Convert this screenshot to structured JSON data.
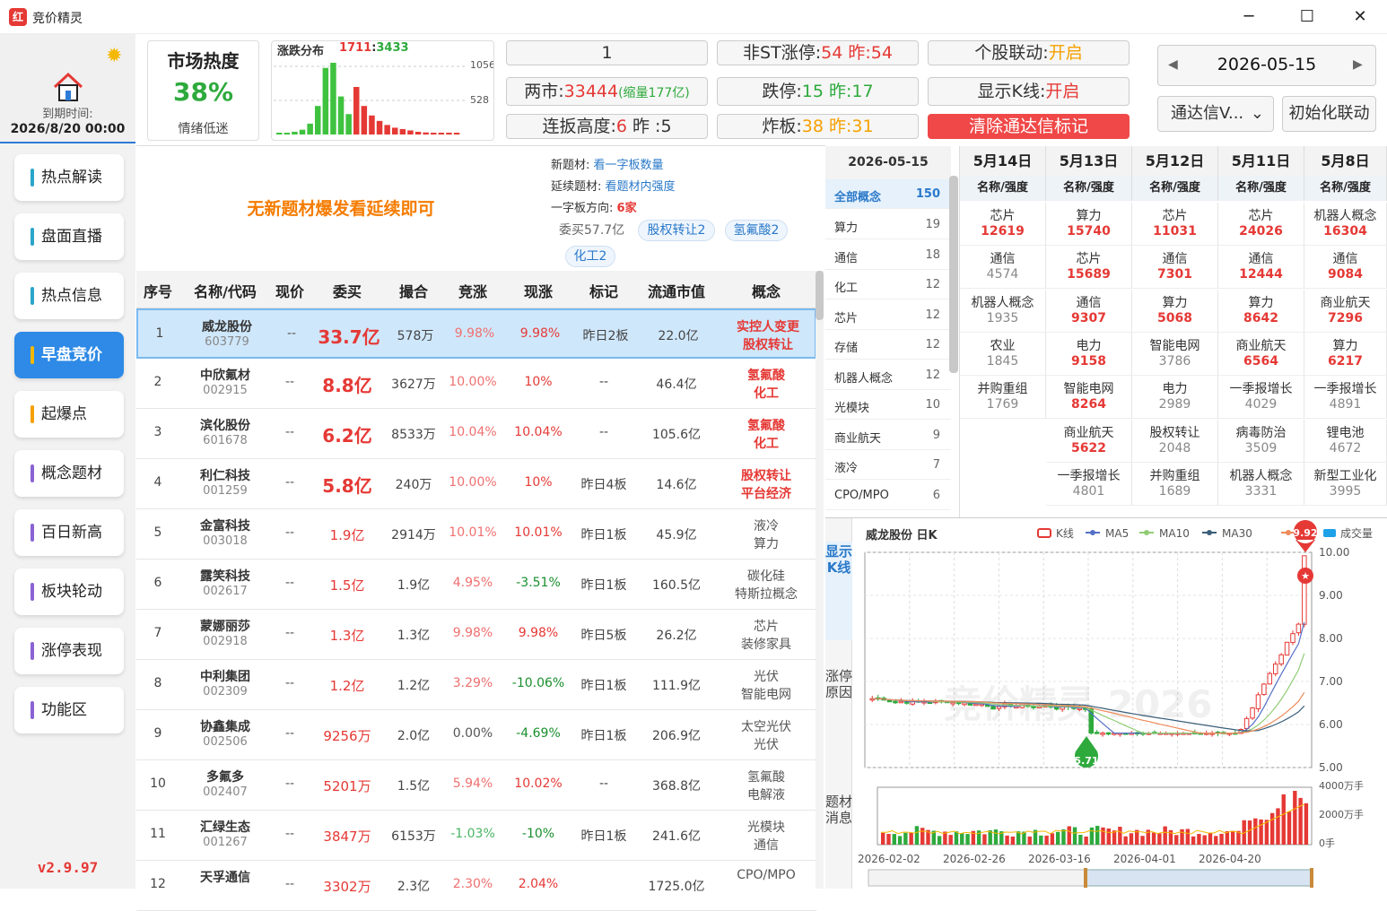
{
  "app": {
    "title": "竞价精灵",
    "icon": "红",
    "min": "─",
    "max": "☐",
    "close": "✕"
  },
  "sidebar": {
    "expire_label": "到期时间:",
    "expire_date": "2026/8/20 00:00",
    "version": "v2.9.97",
    "items": [
      {
        "label": "热点解读",
        "color": "#2aa5c9"
      },
      {
        "label": "盘面直播",
        "color": "#2aa5c9"
      },
      {
        "label": "热点信息",
        "color": "#2aa5c9"
      },
      {
        "label": "早盘竞价",
        "color": "#f5b800"
      },
      {
        "label": "起爆点",
        "color": "#f5a000"
      },
      {
        "label": "概念题材",
        "color": "#8a63d2"
      },
      {
        "label": "百日新高",
        "color": "#8a63d2"
      },
      {
        "label": "板块轮动",
        "color": "#8a63d2"
      },
      {
        "label": "涨停表现",
        "color": "#8a63d2"
      },
      {
        "label": "功能区",
        "color": "#8a63d2"
      }
    ]
  },
  "heat": {
    "title": "市场热度",
    "value": "38%",
    "mood": "情绪低迷"
  },
  "dist": {
    "title": "涨跌分布",
    "up": "1711",
    "sep": ":",
    "down": "3433",
    "tick_high": "1056",
    "tick_mid": "528",
    "bars": [
      {
        "v": 20,
        "c": "g"
      },
      {
        "v": 25,
        "c": "g"
      },
      {
        "v": 40,
        "c": "g"
      },
      {
        "v": 70,
        "c": "g"
      },
      {
        "v": 160,
        "c": "g"
      },
      {
        "v": 420,
        "c": "g"
      },
      {
        "v": 980,
        "c": "g"
      },
      {
        "v": 1056,
        "c": "g"
      },
      {
        "v": 560,
        "c": "g"
      },
      {
        "v": 300,
        "c": "g"
      },
      {
        "v": 700,
        "c": "r"
      },
      {
        "v": 420,
        "c": "r"
      },
      {
        "v": 280,
        "c": "r"
      },
      {
        "v": 200,
        "c": "r"
      },
      {
        "v": 140,
        "c": "r"
      },
      {
        "v": 100,
        "c": "r"
      },
      {
        "v": 80,
        "c": "r"
      },
      {
        "v": 60,
        "c": "r"
      },
      {
        "v": 40,
        "c": "r"
      },
      {
        "v": 30,
        "c": "r"
      },
      {
        "v": 25,
        "c": "r"
      },
      {
        "v": 20,
        "c": "r"
      },
      {
        "v": 15,
        "c": "r"
      },
      {
        "v": 12,
        "c": "r"
      }
    ]
  },
  "stats": {
    "box1": "1",
    "two_market_label": "两市:",
    "two_market_val": "33444",
    "two_market_note": "(缩量177亿)",
    "lianban_label": "连扳高度:",
    "lianban_val": "6",
    "lianban_prev": "昨 :5",
    "nonst_label": "非ST涨停:",
    "nonst_val": "54",
    "nonst_prev": "昨:54",
    "dieting_label": "跌停:",
    "dieting_val": "15",
    "dieting_prev": "昨:17",
    "zhaban_label": "炸板:",
    "zhaban_val": "38",
    "zhaban_prev": "昨:31",
    "link_label": "个股联动:",
    "link_val": "开启",
    "kline_label": "显示K线:",
    "kline_val": "开启",
    "clear_btn": "清除通达信标记"
  },
  "date": {
    "prev": "◀",
    "value": "2026-05-15",
    "next": "▶",
    "combo": "通达信V...",
    "combo_arrow": "⌄",
    "init_btn": "初始化联动"
  },
  "topic": {
    "banner": "无新题材爆发看延续即可",
    "new_label": "新题材:",
    "new_link": "看一字板数量",
    "cont_label": "延续题材:",
    "cont_link": "看题材内强度",
    "dir_label": "一字板方向:",
    "dir_val": "6家",
    "wm": "委买57.7亿",
    "tags": [
      "股权转让2",
      "氢氟酸2",
      "化工2"
    ]
  },
  "table": {
    "headers": [
      "序号",
      "名称/代码",
      "现价",
      "委买",
      "撮合",
      "竞涨",
      "现涨",
      "标记",
      "流通市值",
      "概念"
    ],
    "rows": [
      {
        "no": "1",
        "name": "威龙股份",
        "code": "603779",
        "price": "--",
        "wm": "33.7亿",
        "cuo": "578万",
        "jz": "9.98%",
        "xz": "9.98%",
        "mark": "昨日2板",
        "mv": "22.0亿",
        "c1": "实控人变更",
        "c2": "股权转让",
        "wmc": "red",
        "wmb": "big",
        "jzc": "pink",
        "xzc": "red",
        "cc": "red"
      },
      {
        "no": "2",
        "name": "中欣氟材",
        "code": "002915",
        "price": "--",
        "wm": "8.8亿",
        "cuo": "3627万",
        "jz": "10.00%",
        "xz": "10%",
        "mark": "--",
        "mv": "46.4亿",
        "c1": "氢氟酸",
        "c2": "化工",
        "wmc": "red",
        "wmb": "big",
        "jzc": "pink",
        "xzc": "red",
        "cc": "red"
      },
      {
        "no": "3",
        "name": "滨化股份",
        "code": "601678",
        "price": "--",
        "wm": "6.2亿",
        "cuo": "8533万",
        "jz": "10.04%",
        "xz": "10.04%",
        "mark": "--",
        "mv": "105.6亿",
        "c1": "氢氟酸",
        "c2": "化工",
        "wmc": "red",
        "wmb": "big",
        "jzc": "pink",
        "xzc": "red",
        "cc": "red"
      },
      {
        "no": "4",
        "name": "利仁科技",
        "code": "001259",
        "price": "--",
        "wm": "5.8亿",
        "cuo": "240万",
        "jz": "10.00%",
        "xz": "10%",
        "mark": "昨日4板",
        "mv": "14.6亿",
        "c1": "股权转让",
        "c2": "平台经济",
        "wmc": "red",
        "wmb": "big",
        "jzc": "pink",
        "xzc": "red",
        "cc": "red"
      },
      {
        "no": "5",
        "name": "金富科技",
        "code": "003018",
        "price": "--",
        "wm": "1.9亿",
        "cuo": "2914万",
        "jz": "10.01%",
        "xz": "10.01%",
        "mark": "昨日1板",
        "mv": "45.9亿",
        "c1": "液冷",
        "c2": "算力",
        "wmc": "red",
        "wmb": "",
        "jzc": "pink",
        "xzc": "red",
        "cc": "gray"
      },
      {
        "no": "6",
        "name": "露笑科技",
        "code": "002617",
        "price": "--",
        "wm": "1.5亿",
        "cuo": "1.9亿",
        "jz": "4.95%",
        "xz": "-3.51%",
        "mark": "昨日1板",
        "mv": "160.5亿",
        "c1": "碳化硅",
        "c2": "特斯拉概念",
        "wmc": "red",
        "wmb": "",
        "jzc": "pink",
        "xzc": "green",
        "cc": "gray"
      },
      {
        "no": "7",
        "name": "蒙娜丽莎",
        "code": "002918",
        "price": "--",
        "wm": "1.3亿",
        "cuo": "1.3亿",
        "jz": "9.98%",
        "xz": "9.98%",
        "mark": "昨日5板",
        "mv": "26.2亿",
        "c1": "芯片",
        "c2": "装修家具",
        "wmc": "red",
        "wmb": "",
        "jzc": "pink",
        "xzc": "red",
        "cc": "gray"
      },
      {
        "no": "8",
        "name": "中利集团",
        "code": "002309",
        "price": "--",
        "wm": "1.2亿",
        "cuo": "1.2亿",
        "jz": "3.29%",
        "xz": "-10.06%",
        "mark": "昨日1板",
        "mv": "111.9亿",
        "c1": "光伏",
        "c2": "智能电网",
        "wmc": "red",
        "wmb": "",
        "jzc": "pink",
        "xzc": "green",
        "cc": "gray"
      },
      {
        "no": "9",
        "name": "协鑫集成",
        "code": "002506",
        "price": "--",
        "wm": "9256万",
        "cuo": "2.0亿",
        "jz": "0.00%",
        "xz": "-4.69%",
        "mark": "昨日1板",
        "mv": "206.9亿",
        "c1": "太空光伏",
        "c2": "光伏",
        "wmc": "red",
        "wmb": "",
        "jzc": "gray",
        "xzc": "green",
        "cc": "gray"
      },
      {
        "no": "10",
        "name": "多氟多",
        "code": "002407",
        "price": "--",
        "wm": "5201万",
        "cuo": "1.5亿",
        "jz": "5.94%",
        "xz": "10.02%",
        "mark": "--",
        "mv": "368.8亿",
        "c1": "氢氟酸",
        "c2": "电解液",
        "wmc": "red",
        "wmb": "",
        "jzc": "pink",
        "xzc": "red",
        "cc": "gray"
      },
      {
        "no": "11",
        "name": "汇绿生态",
        "code": "001267",
        "price": "--",
        "wm": "3847万",
        "cuo": "6153万",
        "jz": "-1.03%",
        "xz": "-10%",
        "mark": "昨日1板",
        "mv": "241.6亿",
        "c1": "光模块",
        "c2": "通信",
        "wmc": "red",
        "wmb": "",
        "jzc": "lgreen",
        "xzc": "green",
        "cc": "gray"
      },
      {
        "no": "12",
        "name": "天孚通信",
        "code": "",
        "price": "--",
        "wm": "3302万",
        "cuo": "2.3亿",
        "jz": "2.30%",
        "xz": "2.04%",
        "mark": "",
        "mv": "1725.0亿",
        "c1": "CPO/MPO",
        "c2": "",
        "wmc": "red",
        "wmb": "",
        "jzc": "pink",
        "xzc": "red",
        "cc": "gray"
      }
    ]
  },
  "concepts": {
    "date": "2026-05-15",
    "all_label": "全部概念",
    "all_count": "150",
    "items": [
      {
        "n": "算力",
        "c": "19"
      },
      {
        "n": "通信",
        "c": "18"
      },
      {
        "n": "化工",
        "c": "12"
      },
      {
        "n": "芯片",
        "c": "12"
      },
      {
        "n": "存储",
        "c": "12"
      },
      {
        "n": "机器人概念",
        "c": "12"
      },
      {
        "n": "光模块",
        "c": "10"
      },
      {
        "n": "商业航天",
        "c": "9"
      },
      {
        "n": "液冷",
        "c": "7"
      },
      {
        "n": "CPO/MPO",
        "c": "6"
      }
    ]
  },
  "days": {
    "sub": "名称/强度",
    "cols": [
      {
        "head": "5月14日",
        "cells": [
          {
            "n": "芯片",
            "v": "12619",
            "hot": true
          },
          {
            "n": "通信",
            "v": "4574",
            "hot": false
          },
          {
            "n": "机器人概念",
            "v": "1935",
            "hot": false
          },
          {
            "n": "农业",
            "v": "1845",
            "hot": false
          },
          {
            "n": "并购重组",
            "v": "1769",
            "hot": false
          }
        ]
      },
      {
        "head": "5月13日",
        "cells": [
          {
            "n": "算力",
            "v": "15740",
            "hot": true
          },
          {
            "n": "芯片",
            "v": "15689",
            "hot": true
          },
          {
            "n": "通信",
            "v": "9307",
            "hot": true
          },
          {
            "n": "电力",
            "v": "9158",
            "hot": true
          },
          {
            "n": "智能电网",
            "v": "8264",
            "hot": true
          },
          {
            "n": "商业航天",
            "v": "5622",
            "hot": true
          },
          {
            "n": "一季报增长",
            "v": "4801",
            "hot": false
          }
        ]
      },
      {
        "head": "5月12日",
        "cells": [
          {
            "n": "芯片",
            "v": "11031",
            "hot": true
          },
          {
            "n": "通信",
            "v": "7301",
            "hot": true
          },
          {
            "n": "算力",
            "v": "5068",
            "hot": true
          },
          {
            "n": "智能电网",
            "v": "3786",
            "hot": false
          },
          {
            "n": "电力",
            "v": "2989",
            "hot": false
          },
          {
            "n": "股权转让",
            "v": "2048",
            "hot": false
          },
          {
            "n": "并购重组",
            "v": "1689",
            "hot": false
          }
        ]
      },
      {
        "head": "5月11日",
        "cells": [
          {
            "n": "芯片",
            "v": "24026",
            "hot": true
          },
          {
            "n": "通信",
            "v": "12444",
            "hot": true
          },
          {
            "n": "算力",
            "v": "8642",
            "hot": true
          },
          {
            "n": "商业航天",
            "v": "6564",
            "hot": true
          },
          {
            "n": "一季报增长",
            "v": "4029",
            "hot": false
          },
          {
            "n": "病毒防治",
            "v": "3509",
            "hot": false
          },
          {
            "n": "机器人概念",
            "v": "3331",
            "hot": false
          }
        ]
      },
      {
        "head": "5月8日",
        "cells": [
          {
            "n": "机器人概念",
            "v": "16304",
            "hot": true
          },
          {
            "n": "通信",
            "v": "9084",
            "hot": true
          },
          {
            "n": "商业航天",
            "v": "7296",
            "hot": true
          },
          {
            "n": "算力",
            "v": "6217",
            "hot": true
          },
          {
            "n": "一季报增长",
            "v": "4891",
            "hot": false
          },
          {
            "n": "锂电池",
            "v": "4672",
            "hot": false
          },
          {
            "n": "新型工业化",
            "v": "3995",
            "hot": false
          }
        ]
      }
    ]
  },
  "side_tabs": {
    "kline": "显示K线",
    "reason": "涨停原因",
    "news": "题材消息"
  },
  "kchart": {
    "title": "威龙股份 日K",
    "legend": [
      "K线",
      "MA5",
      "MA10",
      "MA30",
      "M"
    ],
    "vol_legend": "成交量",
    "y_ticks": [
      "10.00",
      "9.00",
      "8.00",
      "7.00",
      "6.00",
      "5.00"
    ],
    "vol_ticks": [
      "4000万手",
      "2000万手",
      "0手"
    ],
    "x_ticks": [
      "2026-02-02",
      "2026-02-26",
      "2026-03-16",
      "2026-04-01",
      "2026-04-20"
    ],
    "max_label": "9.92",
    "min_label": "5.71",
    "watermark": "竞价精灵 2026",
    "colors": {
      "up": "#e53935",
      "down": "#2eaa3d",
      "ma5": "#5470c6",
      "ma10": "#91cc75",
      "ma30": "#3b5f7a",
      "m": "#ee8a5a",
      "vol": "#1ea1e8"
    }
  }
}
